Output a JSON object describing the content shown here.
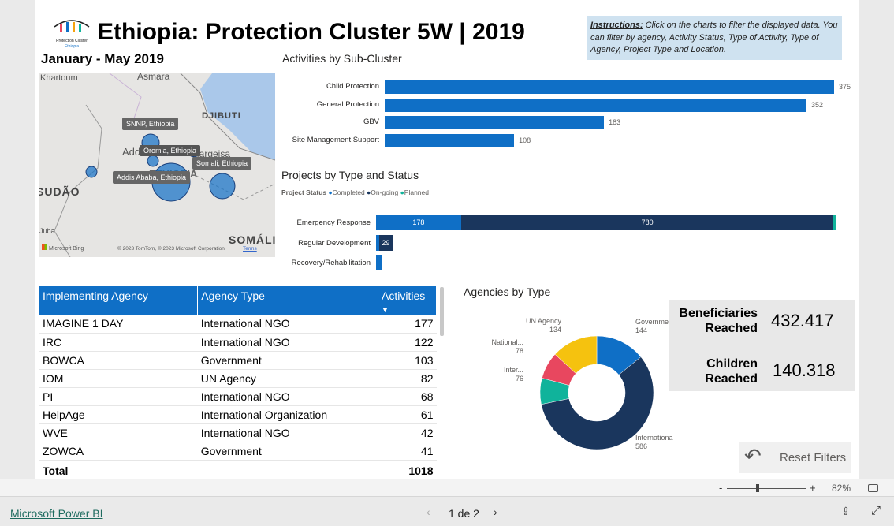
{
  "header": {
    "title": "Ethiopia: Protection Cluster 5W | 2019",
    "period": "January - May 2019",
    "logo_text": "Protection Cluster Ethiopia",
    "instructions_label": "Instructions:",
    "instructions_text": " Click on the charts to filter the displayed data. You can filter by agency, Activity Status, Type of Activity, Type of Agency, Project Type and Location."
  },
  "map": {
    "labels": [
      "Khartoum",
      "Asmara",
      "DJIBUTI",
      "Addis Ababa",
      "Hargeisa",
      "ETHIOPIA",
      "SUDÃO",
      "Juba",
      "SOMÁLI"
    ],
    "bubbles": [
      {
        "label": "SNNP, Ethiopia"
      },
      {
        "label": "Oromia, Ethiopia"
      },
      {
        "label": "Somali, Ethiopia"
      },
      {
        "label": "Addis Ababa, Ethiopia"
      }
    ],
    "attribution": "© 2023 TomTom, © 2023 Microsoft Corporation",
    "terms": "Terms",
    "bing": "Microsoft Bing"
  },
  "chart_data": [
    {
      "type": "bar",
      "title": "Activities by Sub-Cluster",
      "categories": [
        "Child Protection",
        "General Protection",
        "GBV",
        "Site Management Support"
      ],
      "values": [
        375,
        352,
        183,
        108
      ],
      "color": "#0f6fc6"
    },
    {
      "type": "bar",
      "stacked": true,
      "title": "Projects by Type and Status",
      "legend_title": "Project Status",
      "categories": [
        "Emergency Response",
        "Regular Development",
        "Recovery/Rehabilitation"
      ],
      "series": [
        {
          "name": "Completed",
          "color": "#0f6fc6",
          "values": [
            178,
            6,
            13
          ]
        },
        {
          "name": "On-going",
          "color": "#1a365d",
          "values": [
            780,
            29,
            0
          ]
        },
        {
          "name": "Planned",
          "color": "#10b39b",
          "values": [
            6,
            0,
            0
          ]
        }
      ],
      "data_labels": [
        [
          "178",
          "780",
          ""
        ],
        [
          "",
          "29",
          ""
        ],
        [
          "",
          "",
          ""
        ]
      ]
    },
    {
      "type": "pie",
      "donut": true,
      "title": "Agencies by Type",
      "categories": [
        "Government",
        "International N...",
        "Inter...",
        "National...",
        "UN Agency"
      ],
      "values": [
        144,
        586,
        76,
        78,
        134
      ],
      "colors": [
        "#0f6fc6",
        "#1a365d",
        "#10b39b",
        "#e8475f",
        "#f5c20f"
      ]
    }
  ],
  "table": {
    "headers": [
      "Implementing Agency",
      "Agency Type",
      "Activities"
    ],
    "rows": [
      [
        "IMAGINE 1 DAY",
        "International NGO",
        "177"
      ],
      [
        "IRC",
        "International NGO",
        "122"
      ],
      [
        "BOWCA",
        "Government",
        "103"
      ],
      [
        "IOM",
        "UN Agency",
        "82"
      ],
      [
        "PI",
        "International NGO",
        "68"
      ],
      [
        "HelpAge",
        "International Organization",
        "61"
      ],
      [
        "WVE",
        "International NGO",
        "42"
      ],
      [
        "ZOWCA",
        "Government",
        "41"
      ]
    ],
    "total_label": "Total",
    "total_value": "1018"
  },
  "kpis": [
    {
      "label": "Beneficiaries Reached",
      "value": "432.417"
    },
    {
      "label": "Children Reached",
      "value": "140.318"
    }
  ],
  "reset_label": "Reset Filters",
  "zoom": {
    "minus": "-",
    "plus": "+",
    "level": "82%",
    "value": 82
  },
  "footer": {
    "brand": "Microsoft Power BI",
    "page": "1 de 2"
  }
}
